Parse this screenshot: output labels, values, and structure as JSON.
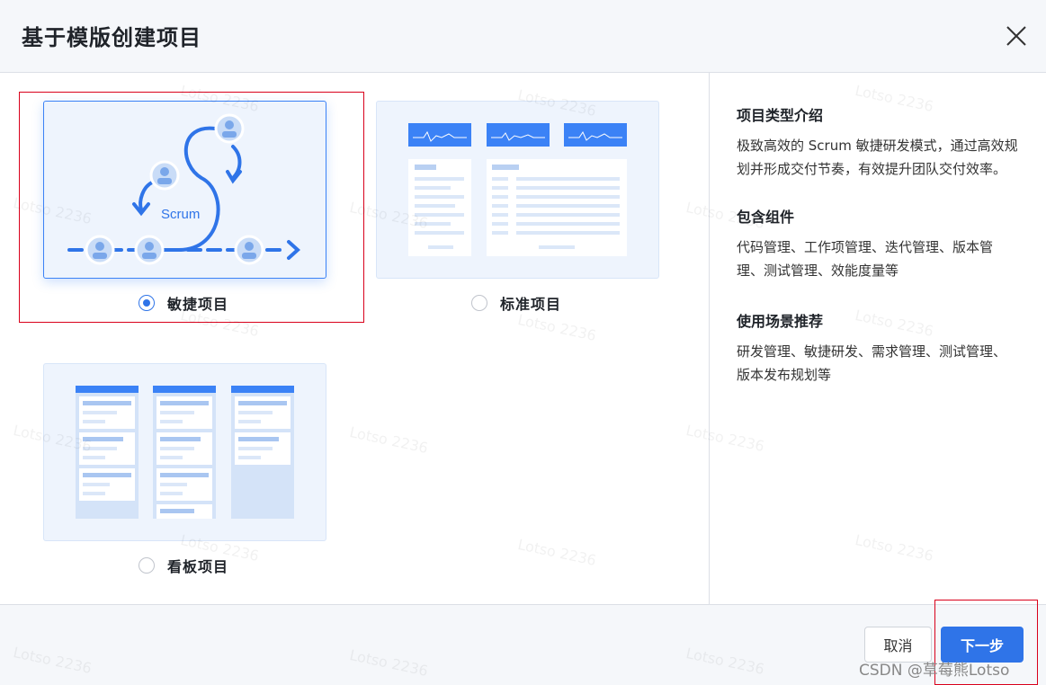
{
  "dialog": {
    "title": "基于模版创建项目",
    "close_icon": "close-icon"
  },
  "templates": [
    {
      "label": "敏捷项目",
      "selected": true,
      "scrum_text": "Scrum"
    },
    {
      "label": "标准项目",
      "selected": false
    },
    {
      "label": "看板项目",
      "selected": false
    }
  ],
  "info": {
    "intro_title": "项目类型介绍",
    "intro_text": "极致高效的 Scrum 敏捷研发模式，通过高效规划并形成交付节奏，有效提升团队交付效率。",
    "includes_title": "包含组件",
    "includes_text": "代码管理、工作项管理、迭代管理、版本管理、测试管理、效能度量等",
    "usage_title": "使用场景推荐",
    "usage_text": "研发管理、敏捷研发、需求管理、测试管理、版本发布规划等"
  },
  "footer": {
    "cancel_label": "取消",
    "next_label": "下一步"
  },
  "watermark": "Lotso 2236",
  "credit": "CSDN @草莓熊Lotso",
  "colors": {
    "primary": "#2f74e8",
    "selection_frame": "#d9001b",
    "thumb_bg": "#eef4fd"
  }
}
